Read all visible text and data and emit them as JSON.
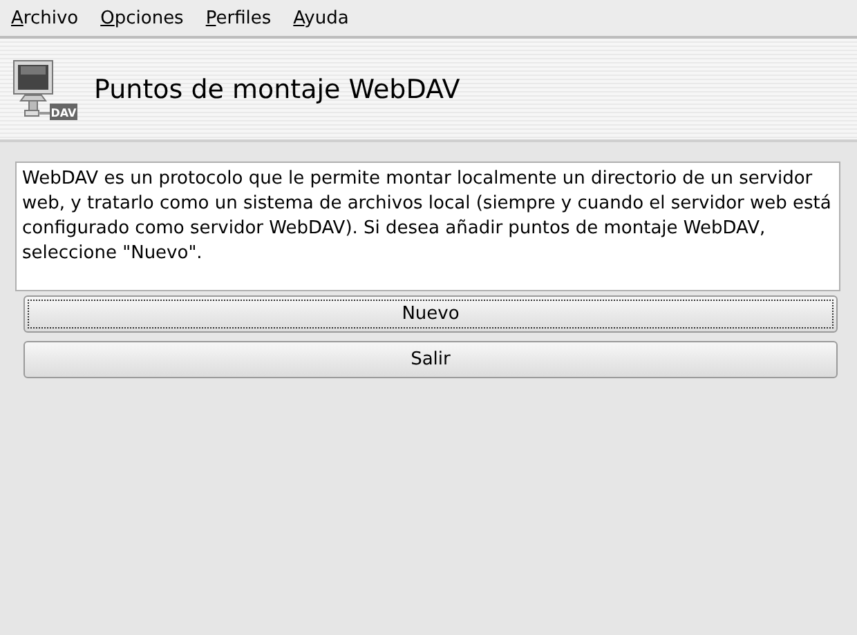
{
  "menu": [
    {
      "label": "Archivo"
    },
    {
      "label": "Opciones"
    },
    {
      "label": "Perfiles"
    },
    {
      "label": "Ayuda"
    }
  ],
  "header": {
    "title": "Puntos de montaje WebDAV",
    "icon_label": "DAV"
  },
  "description": "WebDAV es un protocolo que le permite montar localmente un directorio de un servidor web, y tratarlo como un sistema de archivos local (siempre y cuando el servidor web está configurado como servidor WebDAV). Si desea añadir puntos de montaje WebDAV, seleccione \"Nuevo\".",
  "buttons": [
    {
      "label": "Nuevo",
      "focused": true
    },
    {
      "label": "Salir",
      "focused": false
    }
  ]
}
